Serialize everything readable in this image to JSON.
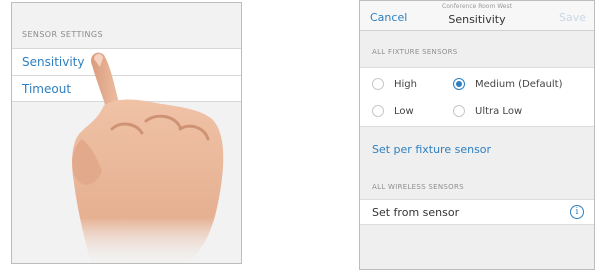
{
  "left": {
    "section_title": "SENSOR SETTINGS",
    "rows": [
      {
        "label": "Sensitivity"
      },
      {
        "label": "Timeout"
      }
    ]
  },
  "right": {
    "nav": {
      "cancel": "Cancel",
      "subtitle": "Conference Room West",
      "title": "Sensitivity",
      "save": "Save"
    },
    "fixture_header": "ALL FIXTURE SENSORS",
    "options": [
      {
        "label": "High",
        "selected": false
      },
      {
        "label": "Medium (Default)",
        "selected": true
      },
      {
        "label": "Low",
        "selected": false
      },
      {
        "label": "Ultra Low",
        "selected": false
      }
    ],
    "set_per_fixture": "Set per fixture sensor",
    "wireless_header": "ALL WIRELESS SENSORS",
    "wireless_row_label": "Set from sensor",
    "info_glyph": "i"
  },
  "colors": {
    "accent": "#2d7fc1",
    "save_disabled": "#c9d8e6",
    "skin": "#e9b89c"
  }
}
